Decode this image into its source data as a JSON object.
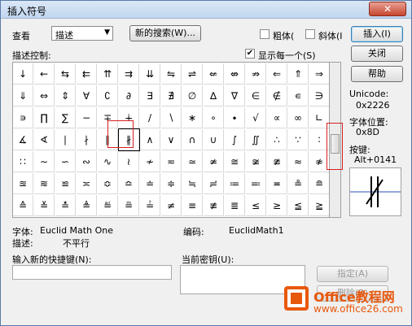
{
  "window": {
    "title": "插入符号",
    "close_symbol": "✕"
  },
  "toolbar": {
    "view_label": "查看",
    "view_value": "描述",
    "new_search_button": "新的搜索(W)...",
    "bold_label": "粗体(",
    "italic_label": "斜体(I",
    "insert_button": "插入(I)",
    "close_button": "关闭",
    "help_button": "帮助"
  },
  "grid_panel": {
    "label": "描述控制:",
    "show_each_label": "显示每一个(S)",
    "show_each_checked": "✔",
    "symbols": [
      [
        "↓",
        "←",
        "⇆",
        "⇇",
        "⇈",
        "⇉",
        "⇊",
        "⇋",
        "⇌",
        "⇍",
        "⇎",
        "⇏",
        "⇐",
        "⇑",
        "⇒"
      ],
      [
        "⇓",
        "⇔",
        "⇕",
        "∀",
        "∁",
        "∂",
        "∃",
        "∄",
        "∅",
        "∆",
        "∇",
        "∈",
        "∉",
        "∊",
        "∋"
      ],
      [
        "∍",
        "∏",
        "∑",
        "−",
        "∓",
        "∔",
        "∕",
        "∖",
        "∗",
        "∘",
        "∙",
        "√",
        "∝",
        "∞",
        "∟"
      ],
      [
        "∡",
        "∢",
        "∣",
        "∤",
        "∥",
        "∦",
        "∧",
        "∨",
        "∩",
        "∪",
        "∫",
        "∬",
        "∴",
        "∵",
        "∶"
      ],
      [
        "∷",
        "∼",
        "∽",
        "∾",
        "∿",
        "≀",
        "≁",
        "≂",
        "≃",
        "≄",
        "≅",
        "≆",
        "≇",
        "≈",
        "≉"
      ],
      [
        "≊",
        "≋",
        "≌",
        "≍",
        "≎",
        "≏",
        "≐",
        "≑",
        "≒",
        "≓",
        "≔",
        "≕",
        "≖",
        "≗",
        "≘"
      ],
      [
        "≙",
        "≚",
        "≛",
        "≜",
        "≝",
        "≞",
        "≟",
        "≠",
        "≡",
        "≢",
        "≣",
        "≤",
        "≥",
        "≦",
        "≧"
      ]
    ]
  },
  "info": {
    "unicode_label": "Unicode:",
    "unicode_value": "0x2226",
    "font_position_label": "字体位置:",
    "font_position_value": "0x8D",
    "shortcut_label": "按键:",
    "shortcut_value": "Alt+0141"
  },
  "details": {
    "font_label": "字体:",
    "font_value": "Euclid Math One",
    "encoding_label": "编码:",
    "encoding_value": "EuclidMath1",
    "description_label": "描述:",
    "description_value": "不平行"
  },
  "shortcut_section": {
    "new_shortcut_label": "输入新的快捷键(N):",
    "current_key_label": "当前密钥(U):",
    "assign_button": "指定(A)",
    "remove_button": "删除(R)"
  },
  "watermark": {
    "title": "Office教程网",
    "url": "www.office26.com"
  }
}
